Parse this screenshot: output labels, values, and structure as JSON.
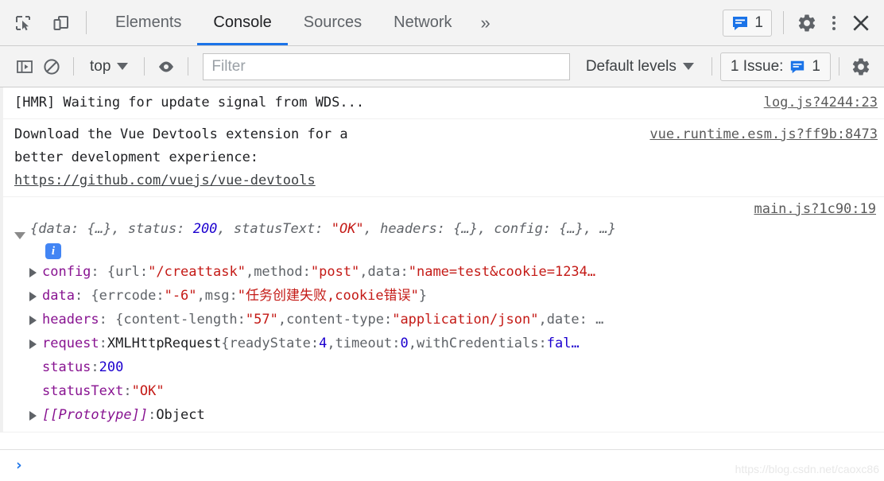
{
  "toolbar": {
    "inspect_icon": "inspect-element-icon",
    "device_icon": "device-toolbar-icon",
    "tabs": [
      {
        "label": "Elements",
        "active": false
      },
      {
        "label": "Console",
        "active": true
      },
      {
        "label": "Sources",
        "active": false
      },
      {
        "label": "Network",
        "active": false
      }
    ],
    "more_tabs": "»",
    "issues_badge_count": "1",
    "settings_icon": "gear-icon",
    "menu_icon": "kebab-menu-icon",
    "close_icon": "close-icon"
  },
  "filterbar": {
    "sidebar_icon": "console-sidebar-icon",
    "clear_icon": "clear-console-icon",
    "context_label": "top",
    "eye_icon": "live-expression-eye-icon",
    "filter_value": "",
    "filter_placeholder": "Filter",
    "levels_label": "Default levels",
    "issue_label": "1 Issue:",
    "issue_count": "1",
    "console_settings_icon": "gear-icon"
  },
  "console": {
    "messages": [
      {
        "text": "[HMR] Waiting for update signal from WDS...",
        "source": "log.js?4244:23"
      },
      {
        "text_line1": "Download the Vue Devtools extension for a",
        "text_line2": "better development experience:",
        "link": "https://github.com/vuejs/vue-devtools",
        "source": "vue.runtime.esm.js?ff9b:8473"
      }
    ],
    "object_log": {
      "source": "main.js?1c90:19",
      "preview_open": "{data: {…}, status: ",
      "preview_status": "200",
      "preview_mid": ", statusText: ",
      "preview_statustext": "\"OK\"",
      "preview_rest": ", headers: {…}, config: {…}, …}",
      "info_icon_glyph": "i",
      "props": [
        {
          "name": "config",
          "expandable": true,
          "segments": [
            {
              "t": ": {",
              "c": "punct"
            },
            {
              "t": "url",
              "c": "pkey"
            },
            {
              "t": ": ",
              "c": "punct"
            },
            {
              "t": "\"/creattask\"",
              "c": "str"
            },
            {
              "t": ", ",
              "c": "punct"
            },
            {
              "t": "method",
              "c": "pkey"
            },
            {
              "t": ": ",
              "c": "punct"
            },
            {
              "t": "\"post\"",
              "c": "str"
            },
            {
              "t": ", ",
              "c": "punct"
            },
            {
              "t": "data",
              "c": "pkey"
            },
            {
              "t": ": ",
              "c": "punct"
            },
            {
              "t": "\"name=test&cookie=1234…",
              "c": "str"
            }
          ]
        },
        {
          "name": "data",
          "expandable": true,
          "segments": [
            {
              "t": ": {",
              "c": "punct"
            },
            {
              "t": "errcode",
              "c": "pkey"
            },
            {
              "t": ": ",
              "c": "punct"
            },
            {
              "t": "\"-6\"",
              "c": "str"
            },
            {
              "t": ", ",
              "c": "punct"
            },
            {
              "t": "msg",
              "c": "pkey"
            },
            {
              "t": ": ",
              "c": "punct"
            },
            {
              "t": "\"任务创建失败,cookie错误\"",
              "c": "str"
            },
            {
              "t": "}",
              "c": "punct"
            }
          ]
        },
        {
          "name": "headers",
          "expandable": true,
          "segments": [
            {
              "t": ": {",
              "c": "punct"
            },
            {
              "t": "content-length",
              "c": "pkey"
            },
            {
              "t": ": ",
              "c": "punct"
            },
            {
              "t": "\"57\"",
              "c": "str"
            },
            {
              "t": ", ",
              "c": "punct"
            },
            {
              "t": "content-type",
              "c": "pkey"
            },
            {
              "t": ": ",
              "c": "punct"
            },
            {
              "t": "\"application/json\"",
              "c": "str"
            },
            {
              "t": ", ",
              "c": "punct"
            },
            {
              "t": "date",
              "c": "pkey"
            },
            {
              "t": ": …",
              "c": "punct"
            }
          ]
        },
        {
          "name": "request",
          "expandable": true,
          "segments": [
            {
              "t": ": ",
              "c": "punct"
            },
            {
              "t": "XMLHttpRequest",
              "c": "plain"
            },
            {
              "t": " {",
              "c": "punct"
            },
            {
              "t": "readyState",
              "c": "pkey"
            },
            {
              "t": ": ",
              "c": "punct"
            },
            {
              "t": "4",
              "c": "num"
            },
            {
              "t": ", ",
              "c": "punct"
            },
            {
              "t": "timeout",
              "c": "pkey"
            },
            {
              "t": ": ",
              "c": "punct"
            },
            {
              "t": "0",
              "c": "num"
            },
            {
              "t": ", ",
              "c": "punct"
            },
            {
              "t": "withCredentials",
              "c": "pkey"
            },
            {
              "t": ": ",
              "c": "punct"
            },
            {
              "t": "fal…",
              "c": "num"
            }
          ]
        },
        {
          "name": "status",
          "expandable": false,
          "segments": [
            {
              "t": ": ",
              "c": "punct"
            },
            {
              "t": "200",
              "c": "num"
            }
          ]
        },
        {
          "name": "statusText",
          "expandable": false,
          "segments": [
            {
              "t": ": ",
              "c": "punct"
            },
            {
              "t": "\"OK\"",
              "c": "str"
            }
          ]
        },
        {
          "name": "[[Prototype]]",
          "expandable": true,
          "italic": true,
          "segments": [
            {
              "t": ": ",
              "c": "punct"
            },
            {
              "t": "Object",
              "c": "plain"
            }
          ]
        }
      ]
    }
  },
  "prompt": {
    "chevron": "›",
    "value": "",
    "watermark": "https://blog.csdn.net/caoxc86"
  }
}
